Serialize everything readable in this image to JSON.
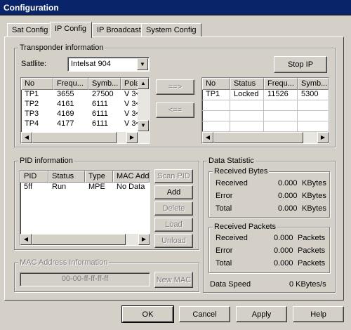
{
  "window": {
    "title": "Configuration"
  },
  "tabs": [
    {
      "label": "Sat Config"
    },
    {
      "label": "IP Config"
    },
    {
      "label": "IP Broadcast"
    },
    {
      "label": "System Config"
    }
  ],
  "transponder": {
    "group_title": "Transponder information",
    "satellite_label": "Satllite:",
    "satellite_value": "Intelsat 904",
    "stop_ip_label": "Stop IP",
    "add_arrow": "==>",
    "remove_arrow": "<==",
    "left_list": {
      "columns": [
        "No",
        "Frequ...",
        "Symb...",
        "Pola"
      ],
      "rows": [
        [
          "TP1",
          "3655",
          "27500",
          "V 3<"
        ],
        [
          "TP2",
          "4161",
          "6111",
          "V 3<"
        ],
        [
          "TP3",
          "4169",
          "6111",
          "V 3<"
        ],
        [
          "TP4",
          "4177",
          "6111",
          "V 3<"
        ]
      ]
    },
    "right_list": {
      "columns": [
        "No",
        "Status",
        "Frequ...",
        "Symb..."
      ],
      "rows": [
        [
          "TP1",
          "Locked",
          "11526",
          "5300"
        ]
      ]
    }
  },
  "pid": {
    "group_title": "PID information",
    "columns": [
      "PID",
      "Status",
      "Type",
      "MAC Add"
    ],
    "rows": [
      [
        "5ff",
        "Run",
        "MPE",
        "No Data"
      ]
    ],
    "buttons": {
      "scan": "Scan PID",
      "add": "Add",
      "delete": "Delete",
      "load": "Load",
      "unload": "Unload"
    }
  },
  "mac": {
    "group_title": "MAC Address Information",
    "value": "00-00-ff-ff-ff-ff",
    "new_mac_label": "New MAC"
  },
  "stats": {
    "group_title": "Data Statistic",
    "bytes": {
      "title": "Received Bytes",
      "rows": [
        {
          "label": "Received",
          "value": "0.000",
          "unit": "KBytes"
        },
        {
          "label": "Error",
          "value": "0.000",
          "unit": "KBytes"
        },
        {
          "label": "Total",
          "value": "0.000",
          "unit": "KBytes"
        }
      ]
    },
    "packets": {
      "title": "Received Packets",
      "rows": [
        {
          "label": "Received",
          "value": "0.000",
          "unit": "Packets"
        },
        {
          "label": "Error",
          "value": "0.000",
          "unit": "Packets"
        },
        {
          "label": "Total",
          "value": "0.000",
          "unit": "Packets"
        }
      ]
    },
    "speed_label": "Data Speed",
    "speed_value": "0 KBytes/s"
  },
  "footer": {
    "ok": "OK",
    "cancel": "Cancel",
    "apply": "Apply",
    "help": "Help"
  },
  "icons": {
    "dropdown": "chevron-down-icon",
    "scroll_up": "arrow-up-icon",
    "scroll_down": "arrow-down-icon",
    "scroll_left": "arrow-left-icon",
    "scroll_right": "arrow-right-icon"
  },
  "colors": {
    "titlebar": "#0a246a",
    "face": "#d4d0c8"
  }
}
